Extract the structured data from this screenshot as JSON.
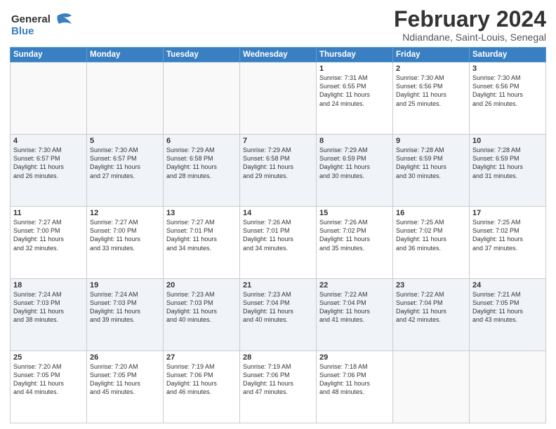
{
  "header": {
    "logo_general": "General",
    "logo_blue": "Blue",
    "month_title": "February 2024",
    "location": "Ndiandane, Saint-Louis, Senegal"
  },
  "days_of_week": [
    "Sunday",
    "Monday",
    "Tuesday",
    "Wednesday",
    "Thursday",
    "Friday",
    "Saturday"
  ],
  "weeks": [
    [
      {
        "day": "",
        "info": ""
      },
      {
        "day": "",
        "info": ""
      },
      {
        "day": "",
        "info": ""
      },
      {
        "day": "",
        "info": ""
      },
      {
        "day": "1",
        "info": "Sunrise: 7:31 AM\nSunset: 6:55 PM\nDaylight: 11 hours\nand 24 minutes."
      },
      {
        "day": "2",
        "info": "Sunrise: 7:30 AM\nSunset: 6:56 PM\nDaylight: 11 hours\nand 25 minutes."
      },
      {
        "day": "3",
        "info": "Sunrise: 7:30 AM\nSunset: 6:56 PM\nDaylight: 11 hours\nand 26 minutes."
      }
    ],
    [
      {
        "day": "4",
        "info": "Sunrise: 7:30 AM\nSunset: 6:57 PM\nDaylight: 11 hours\nand 26 minutes."
      },
      {
        "day": "5",
        "info": "Sunrise: 7:30 AM\nSunset: 6:57 PM\nDaylight: 11 hours\nand 27 minutes."
      },
      {
        "day": "6",
        "info": "Sunrise: 7:29 AM\nSunset: 6:58 PM\nDaylight: 11 hours\nand 28 minutes."
      },
      {
        "day": "7",
        "info": "Sunrise: 7:29 AM\nSunset: 6:58 PM\nDaylight: 11 hours\nand 29 minutes."
      },
      {
        "day": "8",
        "info": "Sunrise: 7:29 AM\nSunset: 6:59 PM\nDaylight: 11 hours\nand 30 minutes."
      },
      {
        "day": "9",
        "info": "Sunrise: 7:28 AM\nSunset: 6:59 PM\nDaylight: 11 hours\nand 30 minutes."
      },
      {
        "day": "10",
        "info": "Sunrise: 7:28 AM\nSunset: 6:59 PM\nDaylight: 11 hours\nand 31 minutes."
      }
    ],
    [
      {
        "day": "11",
        "info": "Sunrise: 7:27 AM\nSunset: 7:00 PM\nDaylight: 11 hours\nand 32 minutes."
      },
      {
        "day": "12",
        "info": "Sunrise: 7:27 AM\nSunset: 7:00 PM\nDaylight: 11 hours\nand 33 minutes."
      },
      {
        "day": "13",
        "info": "Sunrise: 7:27 AM\nSunset: 7:01 PM\nDaylight: 11 hours\nand 34 minutes."
      },
      {
        "day": "14",
        "info": "Sunrise: 7:26 AM\nSunset: 7:01 PM\nDaylight: 11 hours\nand 34 minutes."
      },
      {
        "day": "15",
        "info": "Sunrise: 7:26 AM\nSunset: 7:02 PM\nDaylight: 11 hours\nand 35 minutes."
      },
      {
        "day": "16",
        "info": "Sunrise: 7:25 AM\nSunset: 7:02 PM\nDaylight: 11 hours\nand 36 minutes."
      },
      {
        "day": "17",
        "info": "Sunrise: 7:25 AM\nSunset: 7:02 PM\nDaylight: 11 hours\nand 37 minutes."
      }
    ],
    [
      {
        "day": "18",
        "info": "Sunrise: 7:24 AM\nSunset: 7:03 PM\nDaylight: 11 hours\nand 38 minutes."
      },
      {
        "day": "19",
        "info": "Sunrise: 7:24 AM\nSunset: 7:03 PM\nDaylight: 11 hours\nand 39 minutes."
      },
      {
        "day": "20",
        "info": "Sunrise: 7:23 AM\nSunset: 7:03 PM\nDaylight: 11 hours\nand 40 minutes."
      },
      {
        "day": "21",
        "info": "Sunrise: 7:23 AM\nSunset: 7:04 PM\nDaylight: 11 hours\nand 40 minutes."
      },
      {
        "day": "22",
        "info": "Sunrise: 7:22 AM\nSunset: 7:04 PM\nDaylight: 11 hours\nand 41 minutes."
      },
      {
        "day": "23",
        "info": "Sunrise: 7:22 AM\nSunset: 7:04 PM\nDaylight: 11 hours\nand 42 minutes."
      },
      {
        "day": "24",
        "info": "Sunrise: 7:21 AM\nSunset: 7:05 PM\nDaylight: 11 hours\nand 43 minutes."
      }
    ],
    [
      {
        "day": "25",
        "info": "Sunrise: 7:20 AM\nSunset: 7:05 PM\nDaylight: 11 hours\nand 44 minutes."
      },
      {
        "day": "26",
        "info": "Sunrise: 7:20 AM\nSunset: 7:05 PM\nDaylight: 11 hours\nand 45 minutes."
      },
      {
        "day": "27",
        "info": "Sunrise: 7:19 AM\nSunset: 7:06 PM\nDaylight: 11 hours\nand 46 minutes."
      },
      {
        "day": "28",
        "info": "Sunrise: 7:19 AM\nSunset: 7:06 PM\nDaylight: 11 hours\nand 47 minutes."
      },
      {
        "day": "29",
        "info": "Sunrise: 7:18 AM\nSunset: 7:06 PM\nDaylight: 11 hours\nand 48 minutes."
      },
      {
        "day": "",
        "info": ""
      },
      {
        "day": "",
        "info": ""
      }
    ]
  ]
}
